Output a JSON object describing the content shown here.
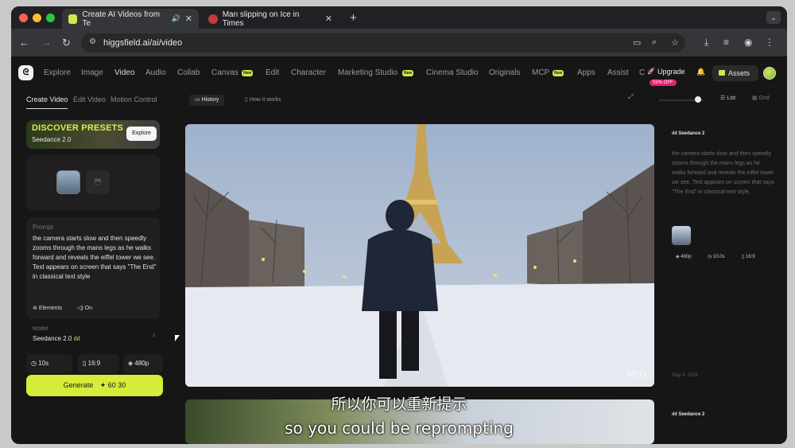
{
  "browser": {
    "tabs": [
      {
        "title": "Create AI Videos from Te",
        "active": true
      },
      {
        "title": "Man slipping on Ice in Times",
        "active": false
      }
    ],
    "url": "higgsfield.ai/ai/video"
  },
  "nav": {
    "items": [
      "Explore",
      "Image",
      "Video",
      "Audio",
      "Collab",
      "Canvas",
      "Edit",
      "Character",
      "Marketing Studio",
      "Cinema Studio",
      "Originals",
      "MCP",
      "Apps",
      "Assist",
      "C"
    ],
    "active": "Video",
    "new_badge": "New",
    "upgrade": "Upgrade",
    "discount": "55% OFF",
    "assets": "Assets"
  },
  "left": {
    "tabs": [
      "Create Video",
      "Edit Video",
      "Motion Control"
    ],
    "presets": {
      "title": "DISCOVER PRESETS",
      "subtitle": "Seedance 2.0",
      "button": "Explore"
    },
    "prompt_label": "Prompt",
    "prompt": "the camera starts slow and then speedly zooms through the mans legs as he walks forward and reveals the eiffel tower we see. Text appears on screen that says \"The End\" in classical text style",
    "elements_label": "Elements",
    "toggle_label": "On",
    "model_label": "Model",
    "model_value": "Seedance 2.0",
    "duration": "10s",
    "ratio": "16:9",
    "resolution": "480p",
    "generate_label": "Generate",
    "generate_cost": "60 30"
  },
  "main": {
    "tabs": [
      "History",
      "How it works"
    ],
    "view_list": "List",
    "view_grid": "Grid",
    "watermark": "Veo"
  },
  "right_panel": {
    "model": "Seedance 2",
    "prompt": "the camera starts slow and then speedly zooms through the mans legs as he walks forward and reveals the eiffel tower we see. Text appears on screen that says \"The End\" in classical text style.",
    "res": "480p",
    "duration": "10.0s",
    "ratio": "16:9",
    "date": "May 4, 2026",
    "model2": "Seedance 2"
  },
  "subtitles": {
    "line1": "所以你可以重新提示",
    "line2": "so you could be reprompting"
  }
}
